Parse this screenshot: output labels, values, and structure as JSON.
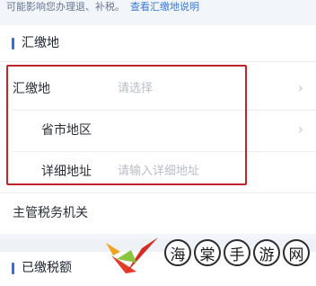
{
  "notice": {
    "text": "可能影响您办理退、补税。",
    "link": "查看汇缴地说明"
  },
  "section1": {
    "title": "汇缴地",
    "rows": [
      {
        "label": "汇缴地",
        "placeholder": "请选择",
        "chevron": "›"
      },
      {
        "label": "省市地区",
        "placeholder": "",
        "chevron": "›"
      },
      {
        "label": "详细地址",
        "placeholder": "请输入详细地址"
      },
      {
        "label": "主管税务机关"
      }
    ]
  },
  "section2": {
    "title": "已缴税额"
  },
  "watermark": {
    "chars": [
      "海",
      "棠",
      "手",
      "游",
      "网"
    ],
    "logo_icon": "check-mark-logo-icon"
  },
  "colors": {
    "accent": "#2f6fe0",
    "highlight_box": "#c0242c",
    "link": "#3c79d6"
  }
}
